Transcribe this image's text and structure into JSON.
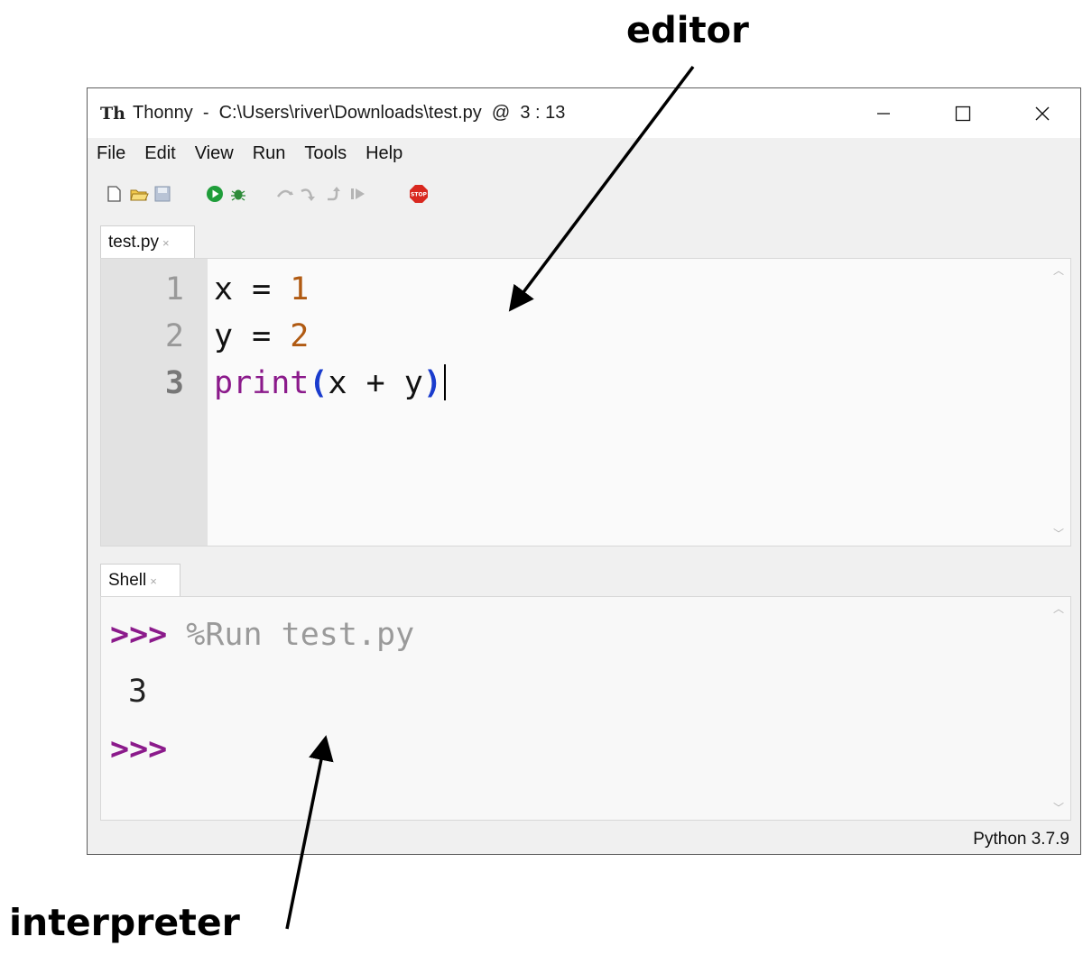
{
  "annotations": {
    "editor_label": "editor",
    "interpreter_label": "interpreter"
  },
  "window": {
    "title": "Thonny  -  C:\\Users\\river\\Downloads\\test.py  @  3 : 13",
    "controls": [
      "minimize",
      "maximize",
      "close"
    ]
  },
  "menu": [
    "File",
    "Edit",
    "View",
    "Run",
    "Tools",
    "Help"
  ],
  "toolbar": {
    "icons": [
      "new-file-icon",
      "open-file-icon",
      "save-icon",
      "run-icon",
      "debug-icon",
      "step-over-icon",
      "step-into-icon",
      "step-out-icon",
      "resume-icon",
      "stop-icon"
    ]
  },
  "editor": {
    "tab_label": "test.py",
    "tab_close": "×",
    "line_numbers": [
      "1",
      "2",
      "3"
    ],
    "current_line": 3,
    "lines": [
      "x = 1",
      "y = 2",
      "print(x + y)"
    ],
    "code_parts": {
      "l1_var": "x",
      "l1_op": " = ",
      "l1_num": "1",
      "l2_var": "y",
      "l2_op": " = ",
      "l2_num": "2",
      "l3_fn": "print",
      "l3_open": "(",
      "l3_args": "x + y",
      "l3_close": ")"
    }
  },
  "shell": {
    "tab_label": "Shell",
    "tab_close": "×",
    "prompt": ">>>",
    "command": " %Run test.py",
    "output": "3"
  },
  "status": {
    "interpreter": "Python 3.7.9"
  },
  "colors": {
    "keyword": "#8b1a8b",
    "number": "#b05a12",
    "paren": "#1a3ccd",
    "prompt": "#8b1a8b",
    "gutter": "#e2e2e2"
  }
}
